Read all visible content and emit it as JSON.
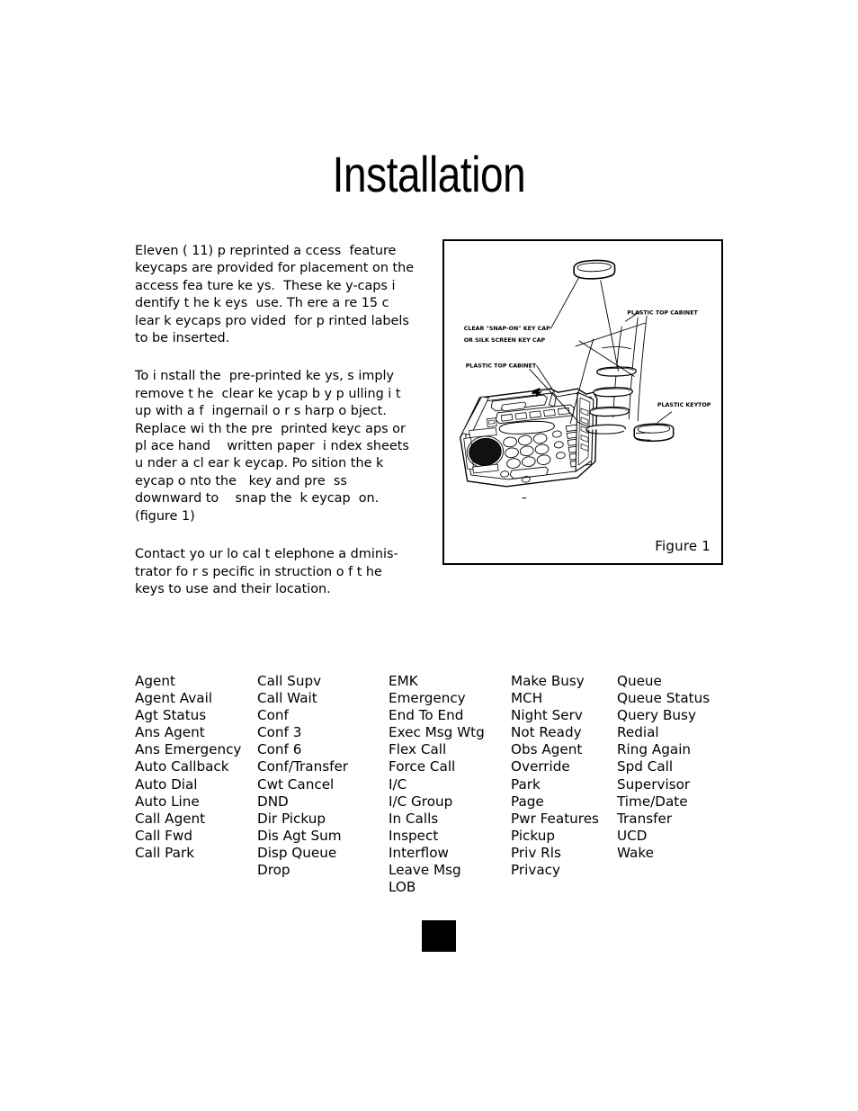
{
  "document": {
    "title": "Installation"
  },
  "body": {
    "paragraphs": [
      "Eleven ( 11) p reprinted a ccess  feature keycaps are provided for placement on the  access fea ture ke ys.  These ke y-caps i dentify t he k eys  use. Th ere a re 15 c lear k eycaps pro vided  for p rinted labels to be inserted.",
      "To i nstall the  pre-printed ke ys, s imply remove t he  clear ke ycap b y p ulling i t up with a f  ingernail o r s harp o bject. Replace wi th the pre  printed keyc aps or pl ace hand    written paper  i ndex sheets u nder a cl ear k eycap. Po sition the k eycap o nto the   key and pre  ss downward to    snap the  k eycap  on. (figure 1)",
      "Contact yo ur lo cal t elephone a dminis-trator fo r s pecific in struction o f t he keys to use and their location."
    ]
  },
  "figure": {
    "caption": "Figure 1",
    "labels": {
      "snap_on_line1": "CLEAR \"SNAP-ON\" KEY CAP",
      "snap_on_line2": "OR SILK SCREEN KEY CAP",
      "plastic_top_cabinet_left": "PLASTIC TOP CABINET",
      "plastic_top_cabinet_right": "PLASTIC TOP CABINET",
      "plastic_keytop": "PLASTIC KEYTOP"
    }
  },
  "feature_keys": {
    "columns": [
      {
        "items": [
          "Agent",
          "Agent Avail",
          "Agt Status",
          "Ans Agent",
          "Ans Emergency",
          "Auto Callback",
          "Auto Dial",
          "Auto Line",
          "Call Agent",
          "Call Fwd",
          "Call Park"
        ]
      },
      {
        "items": [
          "Call Supv",
          "Call Wait",
          "Conf",
          "Conf 3",
          "Conf 6",
          "Conf/Transfer",
          "Cwt Cancel",
          "DND",
          "Dir Pickup",
          "Dis Agt Sum",
          "Disp Queue",
          "Drop"
        ]
      },
      {
        "items": [
          "EMK",
          "Emergency",
          "End To End",
          "Exec Msg Wtg",
          "Flex Call",
          "Force Call",
          "I/C",
          "I/C Group",
          "In Calls",
          "Inspect",
          "Interflow",
          "Leave Msg",
          "LOB"
        ]
      },
      {
        "items": [
          "Make Busy",
          "MCH",
          "Night Serv",
          "Not Ready",
          "Obs Agent",
          "Override",
          "Park",
          "Page",
          "Pwr Features",
          "Pickup",
          "Priv Rls",
          "Privacy"
        ]
      },
      {
        "items": [
          "Queue",
          "Queue Status",
          "Query Busy",
          "Redial",
          "Ring Again",
          "Spd Call",
          "Supervisor",
          "Time/Date",
          "Transfer",
          "UCD",
          "Wake"
        ]
      }
    ]
  },
  "colors": {
    "text": "#000000",
    "background": "#ffffff",
    "figure_border": "#000000",
    "marker": "#000000"
  }
}
